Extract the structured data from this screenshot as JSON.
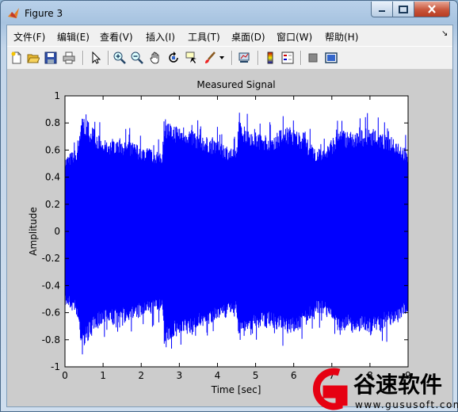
{
  "window": {
    "title": "Figure 3"
  },
  "menu": [
    "文件(F)",
    "编辑(E)",
    "查看(V)",
    "插入(I)",
    "工具(T)",
    "桌面(D)",
    "窗口(W)",
    "帮助(H)"
  ],
  "toolbar": {
    "buttons": [
      "new-figure-icon",
      "open-file-icon",
      "save-icon",
      "print-icon",
      "edit-plot-arrow-icon",
      "zoom-in-icon",
      "zoom-out-icon",
      "pan-hand-icon",
      "rotate-3d-icon",
      "data-cursor-icon",
      "brush-icon",
      "link-plot-icon",
      "colorbar-icon",
      "legend-icon",
      "hide-plot-tools-icon",
      "show-plot-tools-icon"
    ]
  },
  "chart_data": {
    "type": "line",
    "title": "Measured Signal",
    "xlabel": "Time [sec]",
    "ylabel": "Amplitude",
    "xlim": [
      0,
      9
    ],
    "ylim": [
      -1,
      1
    ],
    "xticks": [
      "0",
      "1",
      "2",
      "3",
      "4",
      "5",
      "6",
      "7",
      "8",
      "9"
    ],
    "yticks": [
      "1",
      "0.8",
      "0.6",
      "0.4",
      "0.2",
      "0",
      "-0.2",
      "-0.4",
      "-0.6",
      "-0.8",
      "-1"
    ],
    "grid": false,
    "series": [
      {
        "color": "#0000ff",
        "envelope": {
          "x": [
            0,
            0.3,
            0.45,
            0.8,
            1.0,
            1.4,
            1.8,
            2.2,
            2.55,
            2.6,
            2.8,
            3.2,
            3.6,
            4.0,
            4.4,
            4.5,
            4.55,
            4.7,
            5.0,
            5.4,
            5.8,
            6.2,
            6.6,
            6.8,
            7.2,
            7.6,
            8.0,
            8.4,
            8.6,
            9.0
          ],
          "amplitude": [
            0.55,
            0.62,
            0.88,
            0.75,
            0.68,
            0.7,
            0.66,
            0.62,
            0.6,
            0.85,
            0.8,
            0.78,
            0.72,
            0.68,
            0.62,
            0.6,
            0.82,
            0.8,
            0.74,
            0.72,
            0.78,
            0.74,
            0.62,
            0.62,
            0.76,
            0.74,
            0.78,
            0.72,
            0.72,
            0.6
          ]
        }
      }
    ]
  },
  "watermark": {
    "brand": "谷速软件",
    "url": "www.gususoft.com"
  },
  "colors": {
    "signal": "#0000ff",
    "figure_bg": "#cccccc",
    "axes_bg": "#ffffff",
    "brand_red": "#e60012"
  }
}
